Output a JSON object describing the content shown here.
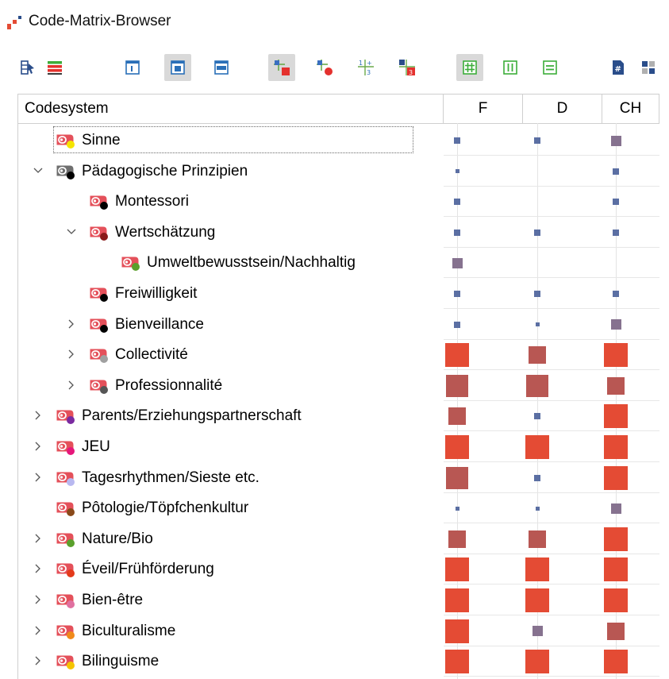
{
  "window": {
    "title": "Code-Matrix-Browser"
  },
  "toolbar": {
    "buttons": [
      {
        "name": "code-selection-button",
        "icon": "select-codes-icon",
        "active": false
      },
      {
        "name": "coded-segments-button",
        "icon": "stacked-bars-icon",
        "active": false
      },
      {
        "name": "view-narrow-button",
        "icon": "narrow-panel-icon",
        "active": false
      },
      {
        "name": "view-medium-button",
        "icon": "medium-panel-icon",
        "active": true
      },
      {
        "name": "view-wide-button",
        "icon": "wide-panel-icon",
        "active": false
      },
      {
        "name": "symbol-squares-button",
        "icon": "squares-matrix-icon",
        "active": true
      },
      {
        "name": "symbol-circles-button",
        "icon": "circles-matrix-icon",
        "active": false
      },
      {
        "name": "show-values-button",
        "icon": "numbers-matrix-icon",
        "active": false
      },
      {
        "name": "show-hits-button",
        "icon": "hits-matrix-icon",
        "active": false
      },
      {
        "name": "grid-view-button",
        "icon": "grid-icon",
        "active": true
      },
      {
        "name": "column-view-button",
        "icon": "columns-icon",
        "active": false
      },
      {
        "name": "row-view-button",
        "icon": "rows-icon",
        "active": false
      },
      {
        "name": "count-button",
        "icon": "hash-document-icon",
        "active": false
      },
      {
        "name": "aggregate-button",
        "icon": "aggregate-numbers-icon",
        "active": false
      }
    ]
  },
  "matrix": {
    "header": {
      "codesystem": "Codesystem",
      "columns": [
        "F",
        "D",
        "CH"
      ]
    },
    "colors": {
      "small": "#5b6fa3",
      "medium": "#86728f",
      "large_muted": "#b85753",
      "large": "#e44b34"
    },
    "rows": [
      {
        "label": "Sinne",
        "level": 1,
        "expander": "none",
        "tag_color": "#e4505a",
        "dot_color": "#f5e400",
        "focused": true,
        "cells": [
          {
            "level": "small"
          },
          {
            "level": "small"
          },
          {
            "level": "medium"
          }
        ]
      },
      {
        "label": "Pädagogische Prinzipien",
        "level": 1,
        "expander": "expanded",
        "tag_color": "#6e6e6e",
        "dot_color": "#000000",
        "cells": [
          {
            "level": "tiny"
          },
          {
            "level": "none"
          },
          {
            "level": "small"
          }
        ]
      },
      {
        "label": "Montessori",
        "level": 2,
        "expander": "none",
        "tag_color": "#e4505a",
        "dot_color": "#000000",
        "cells": [
          {
            "level": "small"
          },
          {
            "level": "none"
          },
          {
            "level": "small"
          }
        ]
      },
      {
        "label": "Wertschätzung",
        "level": 2,
        "expander": "expanded",
        "tag_color": "#e4505a",
        "dot_color": "#8a1a1a",
        "cells": [
          {
            "level": "small"
          },
          {
            "level": "small"
          },
          {
            "level": "small"
          }
        ]
      },
      {
        "label": "Umweltbewusstsein/Nachhaltig",
        "level": 3,
        "expander": "none",
        "tag_color": "#e4505a",
        "dot_color": "#5aa02c",
        "cells": [
          {
            "level": "medium"
          },
          {
            "level": "none"
          },
          {
            "level": "none"
          }
        ]
      },
      {
        "label": "Freiwilligkeit",
        "level": 2,
        "expander": "none",
        "tag_color": "#e4505a",
        "dot_color": "#000000",
        "cells": [
          {
            "level": "small"
          },
          {
            "level": "small"
          },
          {
            "level": "small"
          }
        ]
      },
      {
        "label": "Bienveillance",
        "level": 2,
        "expander": "collapsed",
        "tag_color": "#e4505a",
        "dot_color": "#000000",
        "cells": [
          {
            "level": "small"
          },
          {
            "level": "tiny"
          },
          {
            "level": "medium"
          }
        ]
      },
      {
        "label": "Collectivité",
        "level": 2,
        "expander": "collapsed",
        "tag_color": "#e4505a",
        "dot_color": "#a0a0a0",
        "cells": [
          {
            "level": "large"
          },
          {
            "level": "large_muted_mid"
          },
          {
            "level": "large"
          }
        ]
      },
      {
        "label": "Professionnalité",
        "level": 2,
        "expander": "collapsed",
        "tag_color": "#e4505a",
        "dot_color": "#555555",
        "cells": [
          {
            "level": "large_muted"
          },
          {
            "level": "large_muted"
          },
          {
            "level": "large_muted_mid"
          }
        ]
      },
      {
        "label": "Parents/Erziehungspartnerschaft",
        "level": 1,
        "expander": "collapsed",
        "tag_color": "#e4505a",
        "dot_color": "#7a2aa0",
        "cells": [
          {
            "level": "large_muted_mid"
          },
          {
            "level": "small"
          },
          {
            "level": "large"
          }
        ]
      },
      {
        "label": "JEU",
        "level": 1,
        "expander": "collapsed",
        "tag_color": "#e4505a",
        "dot_color": "#e6177a",
        "cells": [
          {
            "level": "large"
          },
          {
            "level": "large"
          },
          {
            "level": "large"
          }
        ]
      },
      {
        "label": "Tagesrhythmen/Sieste etc.",
        "level": 1,
        "expander": "collapsed",
        "tag_color": "#e4505a",
        "dot_color": "#b8b8f0",
        "cells": [
          {
            "level": "large_muted"
          },
          {
            "level": "small"
          },
          {
            "level": "large"
          }
        ]
      },
      {
        "label": "Pôtologie/Töpfchenkultur",
        "level": 1,
        "expander": "none",
        "tag_color": "#e4505a",
        "dot_color": "#8a4a1a",
        "cells": [
          {
            "level": "tiny"
          },
          {
            "level": "tiny"
          },
          {
            "level": "medium"
          }
        ]
      },
      {
        "label": "Nature/Bio",
        "level": 1,
        "expander": "collapsed",
        "tag_color": "#e4505a",
        "dot_color": "#5aa02c",
        "cells": [
          {
            "level": "large_muted_mid"
          },
          {
            "level": "large_muted_mid"
          },
          {
            "level": "large"
          }
        ]
      },
      {
        "label": "Éveil/Frühförderung",
        "level": 1,
        "expander": "collapsed",
        "tag_color": "#e4505a",
        "dot_color": "#e43a1a",
        "cells": [
          {
            "level": "large"
          },
          {
            "level": "large"
          },
          {
            "level": "large"
          }
        ]
      },
      {
        "label": "Bien-être",
        "level": 1,
        "expander": "collapsed",
        "tag_color": "#e4505a",
        "dot_color": "#e070a0",
        "cells": [
          {
            "level": "large"
          },
          {
            "level": "large"
          },
          {
            "level": "large"
          }
        ]
      },
      {
        "label": "Biculturalisme",
        "level": 1,
        "expander": "collapsed",
        "tag_color": "#e4505a",
        "dot_color": "#f08a1a",
        "cells": [
          {
            "level": "large"
          },
          {
            "level": "medium"
          },
          {
            "level": "large_muted_mid"
          }
        ]
      },
      {
        "label": "Bilinguisme",
        "level": 1,
        "expander": "collapsed",
        "tag_color": "#e4505a",
        "dot_color": "#f5c400",
        "cells": [
          {
            "level": "large"
          },
          {
            "level": "large"
          },
          {
            "level": "large"
          }
        ]
      }
    ]
  }
}
